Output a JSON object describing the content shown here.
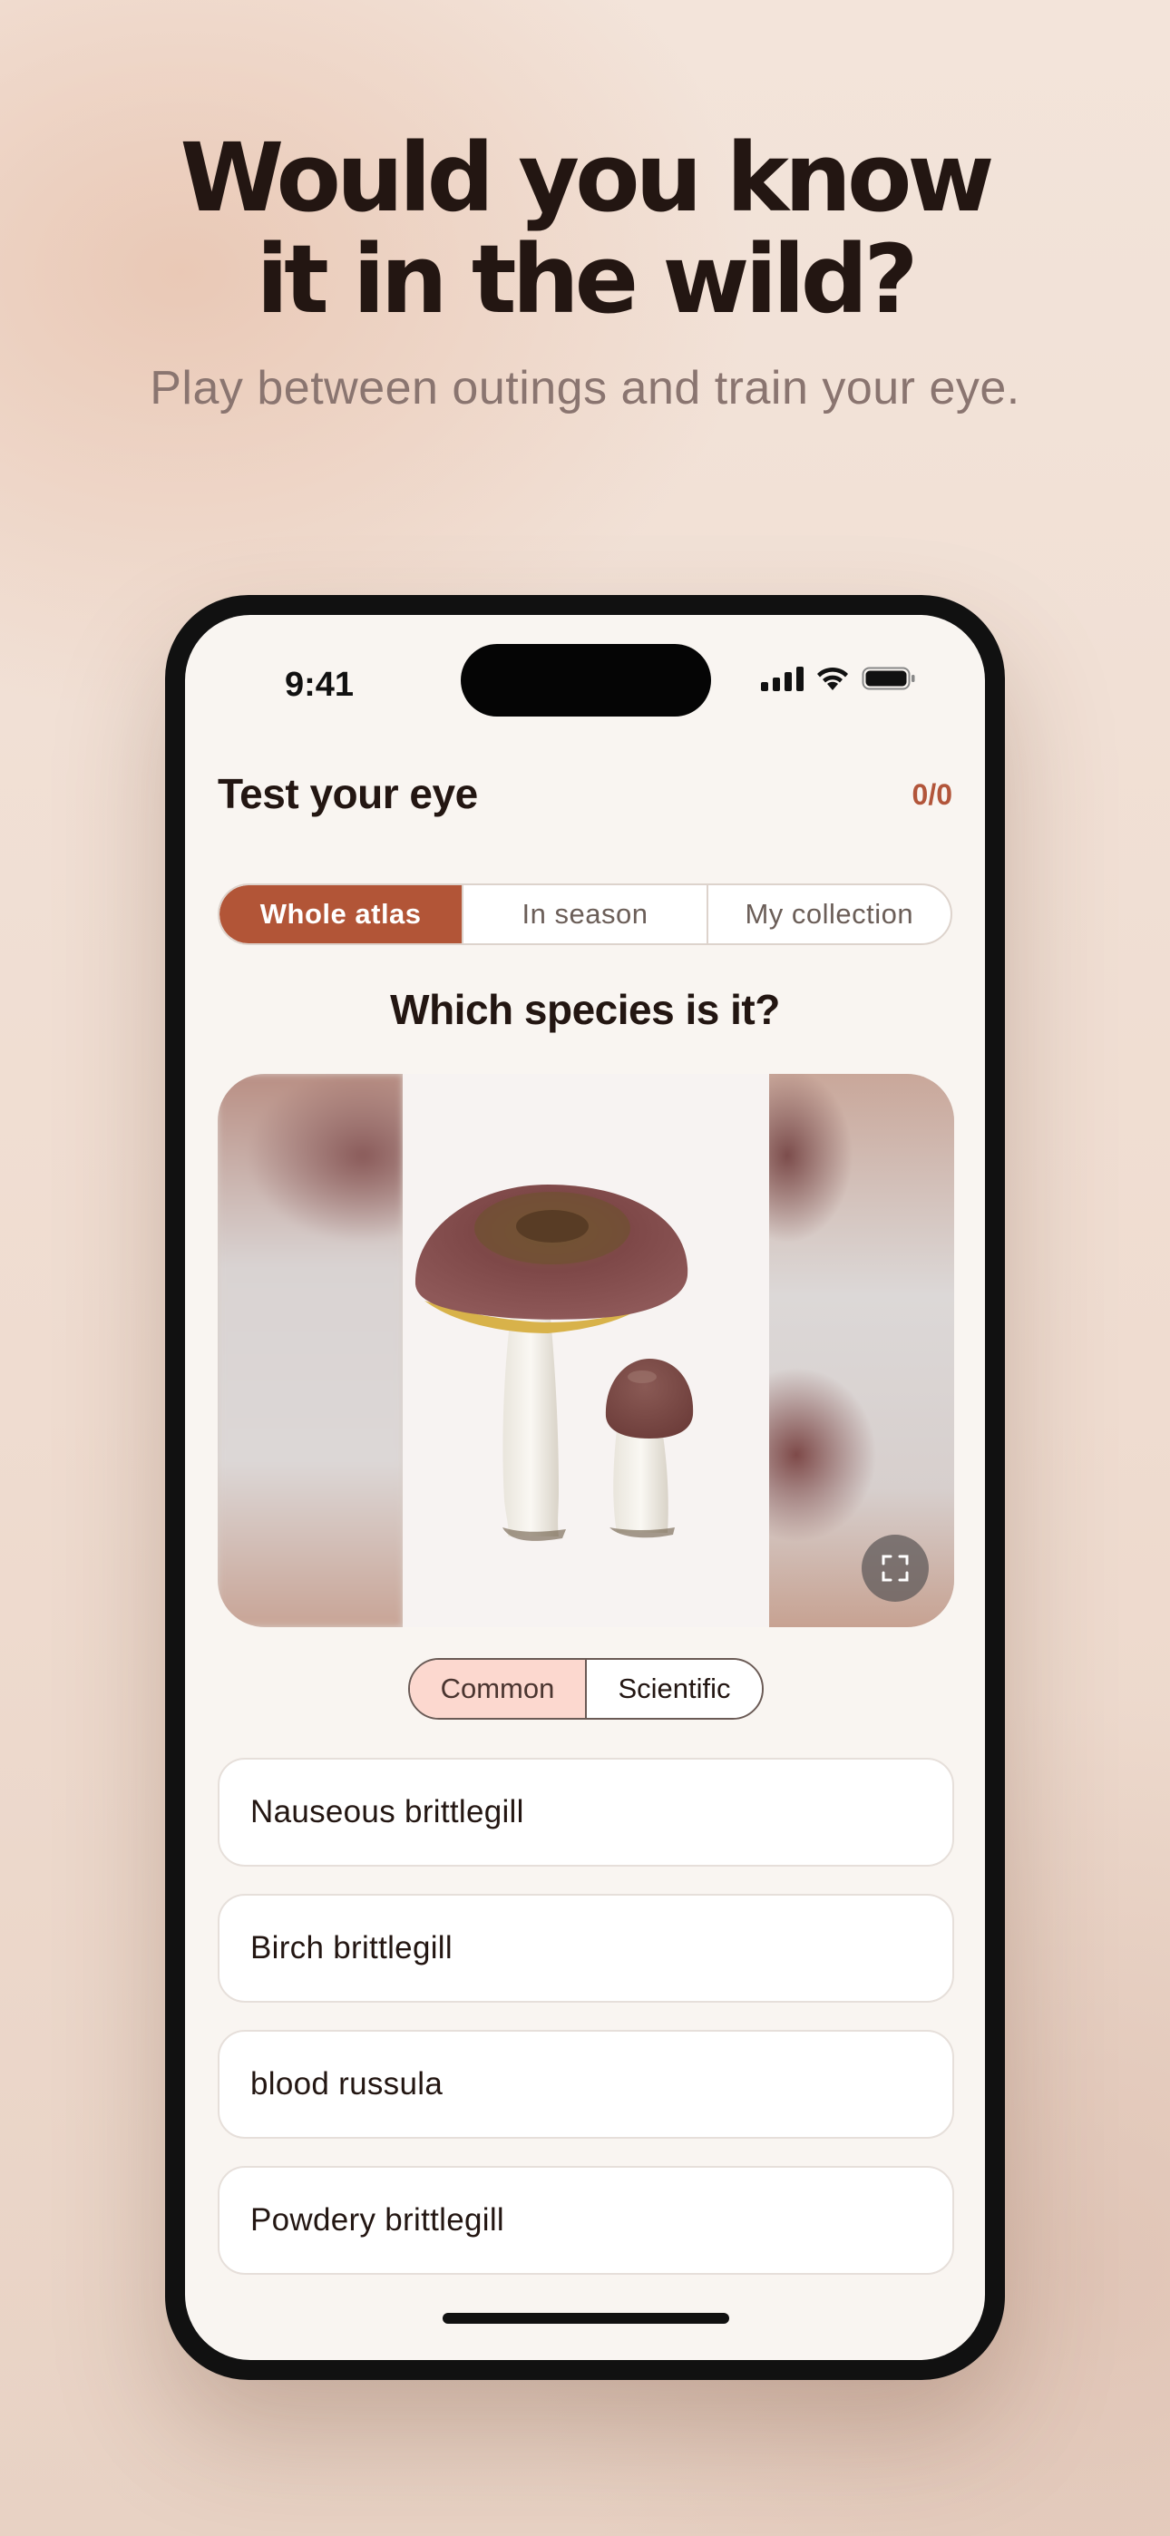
{
  "promo": {
    "headline_line1": "Would you know",
    "headline_line2": "it in the wild?",
    "subtitle": "Play between outings and train your eye."
  },
  "status_bar": {
    "time": "9:41"
  },
  "header": {
    "title": "Test your eye",
    "score": "0/0"
  },
  "scope_tabs": [
    {
      "label": "Whole atlas",
      "selected": true
    },
    {
      "label": "In season",
      "selected": false
    },
    {
      "label": "My collection",
      "selected": false
    }
  ],
  "question": "Which species is it?",
  "name_toggle": [
    {
      "label": "Common",
      "selected": true
    },
    {
      "label": "Scientific",
      "selected": false
    }
  ],
  "answers": [
    {
      "label": "Nauseous brittlegill"
    },
    {
      "label": "Birch brittlegill"
    },
    {
      "label": "blood russula"
    },
    {
      "label": "Powdery brittlegill"
    }
  ],
  "colors": {
    "accent": "#b25537",
    "score": "#b2553a",
    "toggle_selected": "#fcd8cf",
    "background": "#f9f5f1"
  }
}
